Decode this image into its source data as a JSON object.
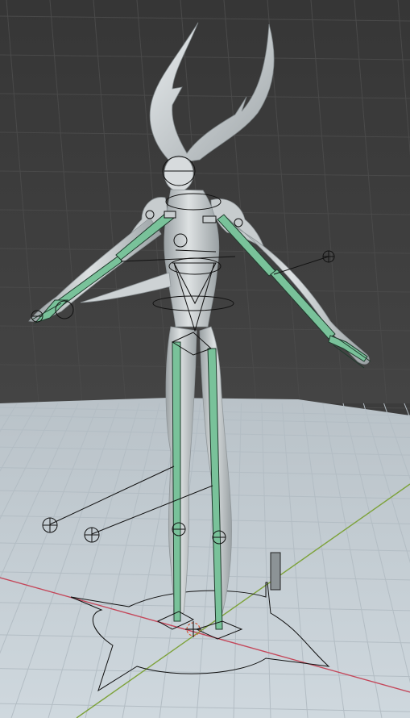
{
  "viewport": {
    "background_color": "#3c3c3c",
    "floor_color": "#c9d2d8",
    "grid_color": "#b7c1c8",
    "x_axis_color": "#c4475a",
    "y_axis_color": "#7da23a"
  },
  "character": {
    "mesh_color": "#c8cdcf",
    "mesh_shade_color": "#8f9699"
  },
  "rig": {
    "bone_color": "#79c29a",
    "bone_outline_color": "#1f3a2c",
    "control_color": "#101010",
    "origin_color": "#d35b3a"
  }
}
